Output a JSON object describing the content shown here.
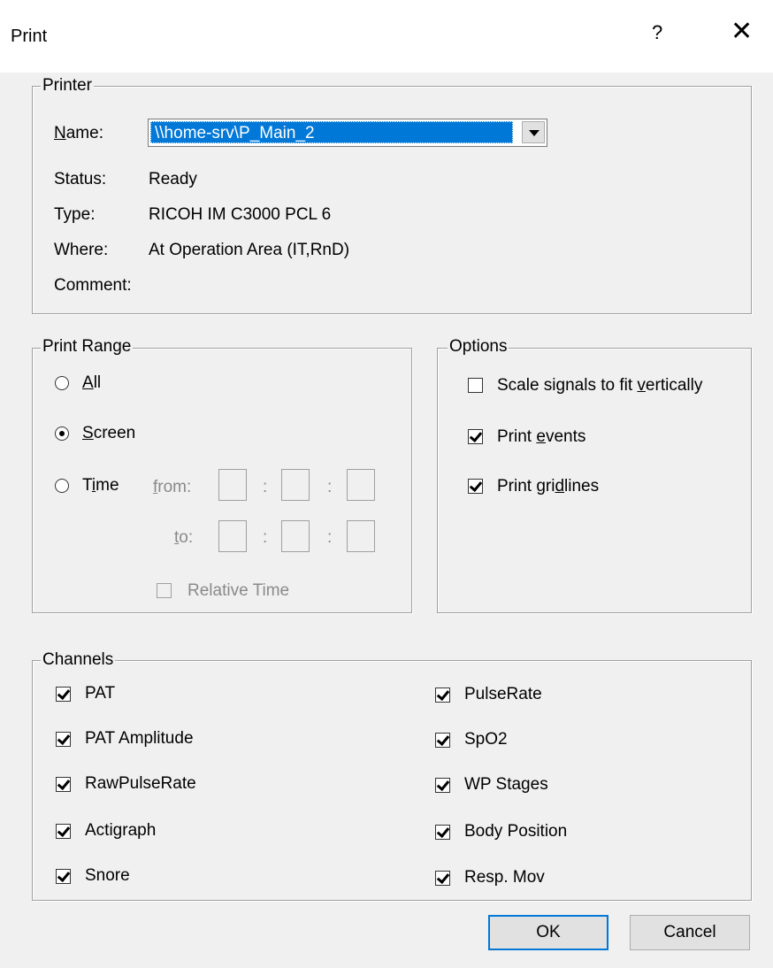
{
  "dialog": {
    "title": "Print",
    "help_glyph": "?",
    "close_glyph": "✕"
  },
  "printer": {
    "group_label": "Printer",
    "name_label": "Name:",
    "name_value": "\\\\home-srv\\P_Main_2",
    "status_label": "Status:",
    "status_value": "Ready",
    "type_label": "Type:",
    "type_value": "RICOH IM C3000 PCL 6",
    "where_label": "Where:",
    "where_value": "At Operation Area (IT,RnD)",
    "comment_label": "Comment:",
    "comment_value": ""
  },
  "print_range": {
    "group_label": "Print Range",
    "all_label": "All",
    "screen_label": "Screen",
    "time_label": "Time",
    "from_label": "from:",
    "to_label": "to:",
    "separator": ":",
    "relative_time_label": "Relative Time",
    "selected": "Screen"
  },
  "options": {
    "group_label": "Options",
    "scale_label": "Scale signals to fit vertically",
    "scale_checked": false,
    "events_label": "Print events",
    "events_checked": true,
    "gridlines_label": "Print gridlines",
    "gridlines_checked": true
  },
  "channels": {
    "group_label": "Channels",
    "left": [
      {
        "label": "PAT",
        "checked": true
      },
      {
        "label": "PAT Amplitude",
        "checked": true
      },
      {
        "label": "RawPulseRate",
        "checked": true
      },
      {
        "label": "Actigraph",
        "checked": true
      },
      {
        "label": "Snore",
        "checked": true
      }
    ],
    "right": [
      {
        "label": "PulseRate",
        "checked": true
      },
      {
        "label": "SpO2",
        "checked": true
      },
      {
        "label": "WP Stages",
        "checked": true
      },
      {
        "label": "Body Position",
        "checked": true
      },
      {
        "label": "Resp. Mov",
        "checked": true
      }
    ]
  },
  "buttons": {
    "ok_label": "OK",
    "cancel_label": "Cancel"
  }
}
